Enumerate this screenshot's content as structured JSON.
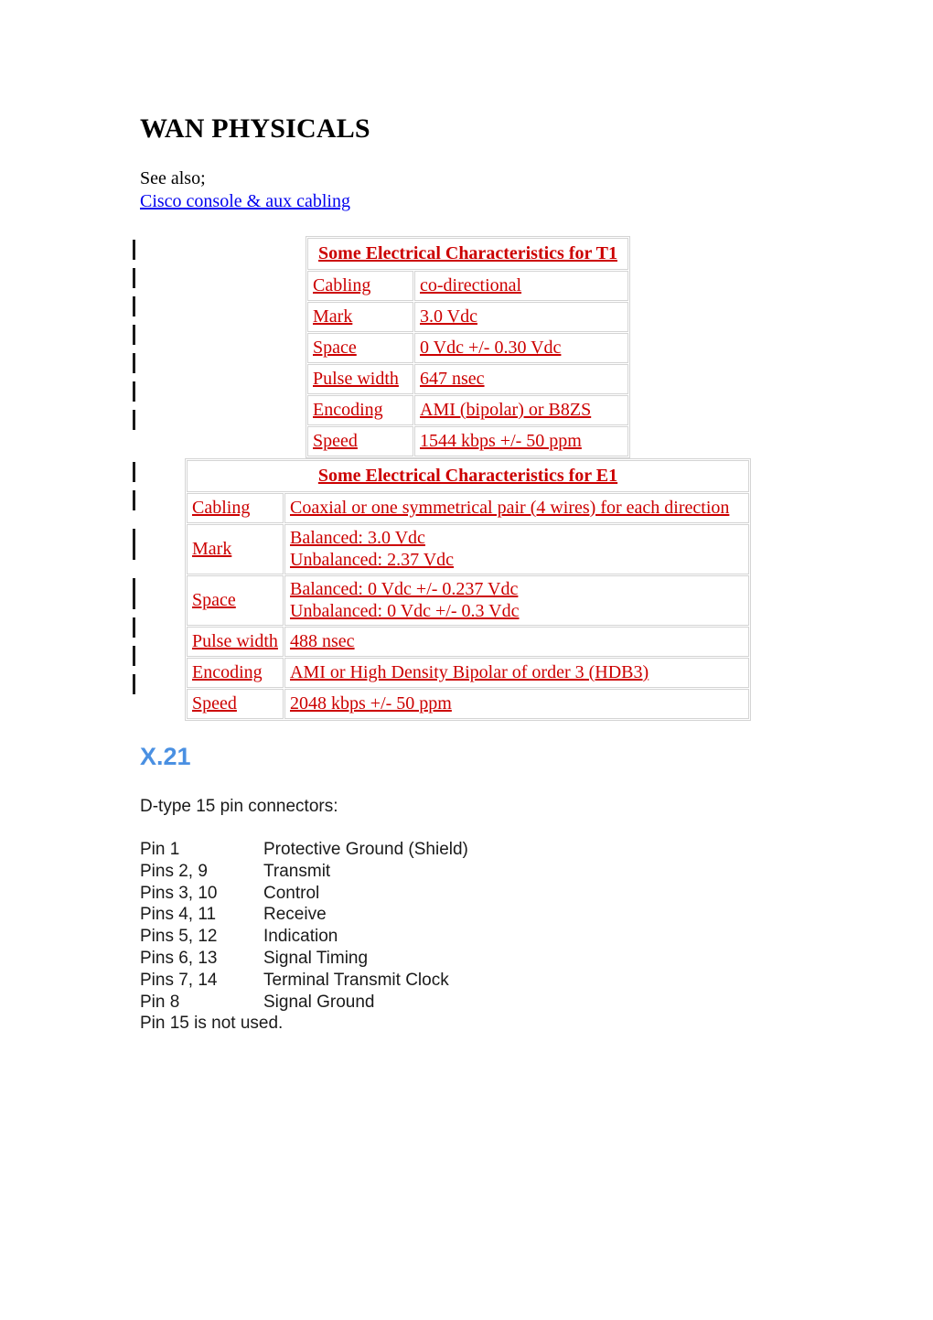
{
  "document": {
    "title": "WAN PHYSICALS",
    "see_also_label": "See also;",
    "see_also_link": "Cisco console & aux cabling ",
    "link_color": "#0000EE",
    "table_text_color": "#CC0000",
    "section_title_color": "#4A90E2"
  },
  "tables": [
    {
      "id": "t1",
      "header": "Some Electrical Characteristics for T1",
      "rows": [
        {
          "label": "Cabling",
          "value": "co-directional"
        },
        {
          "label": "Mark",
          "value": "3.0 Vdc"
        },
        {
          "label": "Space",
          "value": "0 Vdc +/- 0.30 Vdc"
        },
        {
          "label": "Pulse width",
          "value": "647 nsec"
        },
        {
          "label": "Encoding",
          "value": "AMI (bipolar) or B8ZS"
        },
        {
          "label": "Speed",
          "value": "1544 kbps +/- 50 ppm"
        }
      ]
    },
    {
      "id": "e1",
      "header": "Some Electrical Characteristics for E1",
      "rows": [
        {
          "label": "Cabling",
          "value": "Coaxial or one symmetrical pair (4 wires) for each direction"
        },
        {
          "label": "Mark",
          "value_line1": "Balanced: 3.0 Vdc",
          "value_line2": "Unbalanced: 2.37 Vdc"
        },
        {
          "label": "Space",
          "value_line1": "Balanced: 0 Vdc +/- 0.237 Vdc",
          "value_line2": "Unbalanced: 0 Vdc +/- 0.3 Vdc"
        },
        {
          "label": "Pulse width",
          "value": "488 nsec"
        },
        {
          "label": "Encoding",
          "value": "AMI or High Density Bipolar of order 3 (HDB3)"
        },
        {
          "label": "Speed",
          "value": "2048 kbps +/- 50 ppm"
        }
      ]
    }
  ],
  "x21": {
    "section_title": "X.21",
    "intro": "D-type 15 pin connectors:",
    "pins": [
      {
        "label": "Pin 1",
        "desc": "Protective Ground (Shield)"
      },
      {
        "label": "Pins 2, 9",
        "desc": "Transmit"
      },
      {
        "label": "Pins 3, 10",
        "desc": "Control"
      },
      {
        "label": "Pins 4, 11",
        "desc": "Receive"
      },
      {
        "label": "Pins 5, 12",
        "desc": "Indication"
      },
      {
        "label": "Pins 6, 13",
        "desc": "Signal Timing"
      },
      {
        "label": "Pins 7, 14",
        "desc": "Terminal Transmit Clock"
      },
      {
        "label": "Pin 8",
        "desc": "Signal Ground"
      }
    ],
    "note": "Pin 15 is not used."
  }
}
